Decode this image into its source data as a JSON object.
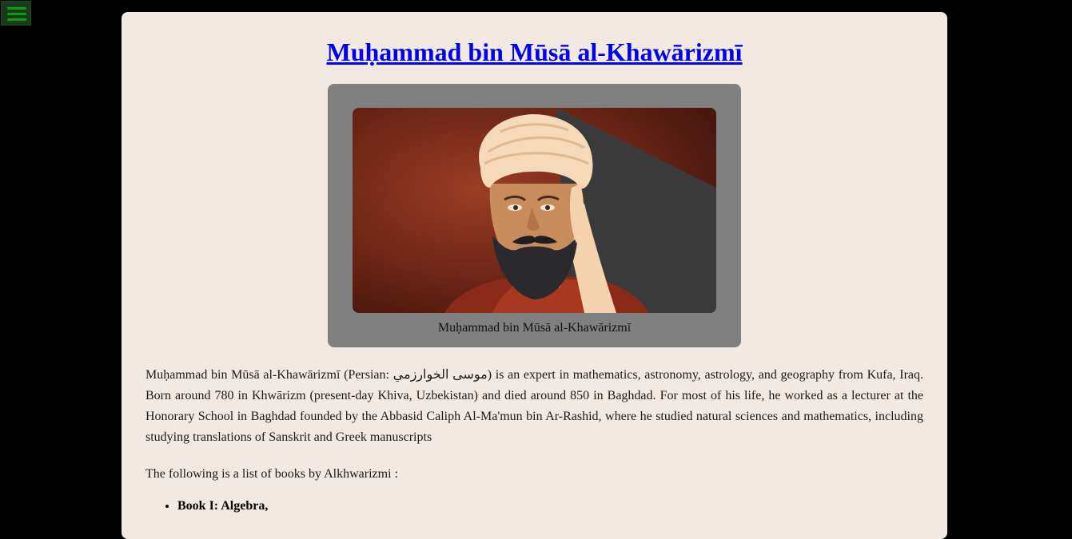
{
  "menu": {
    "icon": "hamburger-menu-icon",
    "color": "#0aa00a"
  },
  "article": {
    "title": "Muḥammad bin Mūsā al-Khawārizmī",
    "figure_caption": "Muḥammad bin Mūsā al-Khawārizmī",
    "paragraph_1": "Muḥammad bin Mūsā al-Khawārizmī (Persian: موسى الخوارزمي) is an expert in mathematics, astronomy, astrology, and geography from Kufa, Iraq. Born around 780 in Khwārizm (present-day Khiva, Uzbekistan) and died around 850 in Baghdad. For most of his life, he worked as a lecturer at the Honorary School in Baghdad founded by the Abbasid Caliph Al-Ma'mun bin Ar-Rashid, where he studied natural sciences and mathematics, including studying translations of Sanskrit and Greek manuscripts",
    "paragraph_2": "The following is a list of books by Alkhwarizmi :",
    "books": [
      "Book I: Algebra,"
    ]
  },
  "colors": {
    "page_background": "#000000",
    "card_background": "#f2e9e3",
    "figure_background": "#808080",
    "link": "#0000ee"
  }
}
